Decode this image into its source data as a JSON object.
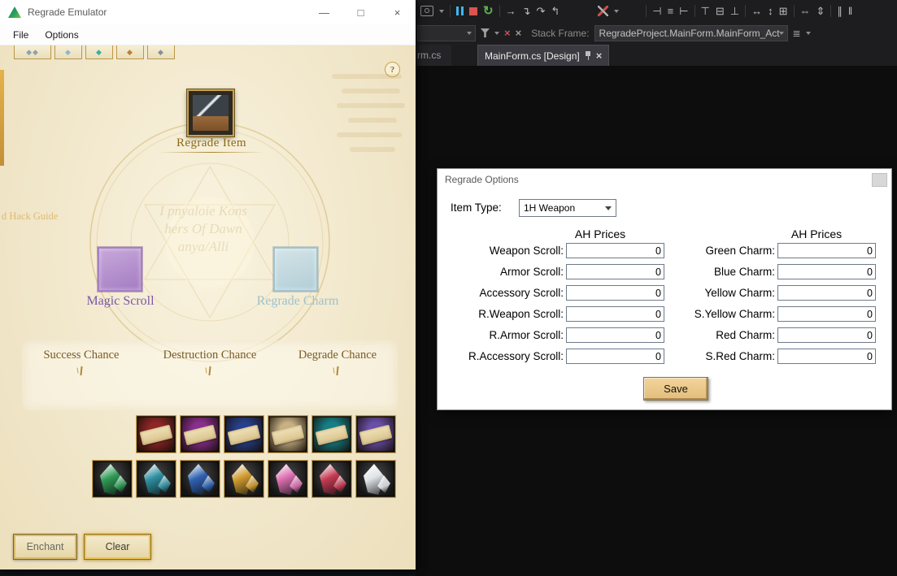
{
  "colors": {
    "parchment": "#f1e8cf",
    "gold_trim": "#c9a24a",
    "vs_background": "#0d0d0e",
    "save_button": "#e8c485"
  },
  "emulator": {
    "title": "Regrade Emulator",
    "menu": {
      "file": "File",
      "options": "Options"
    },
    "controls": {
      "minimize": "—",
      "maximize": "□",
      "close": "×"
    },
    "help": "?",
    "labels": {
      "regrade_item": "Regrade Item",
      "magic_scroll": "Magic Scroll",
      "regrade_charm": "Regrade Charm"
    },
    "chances": [
      "Success Chance",
      "Destruction Chance",
      "Degrade Chance"
    ],
    "buttons": {
      "enchant": "Enchant",
      "clear": "Clear"
    },
    "watermarks": {
      "side": "d Hack Guide",
      "circle": [
        "I pnyaloie Kons",
        "hers Of Dawn",
        "anya/Alli"
      ]
    },
    "tabs": [
      {
        "glyph": "◆◆",
        "color": "#8fa3ad"
      },
      {
        "glyph": "◆",
        "color": "#96b4c6"
      },
      {
        "glyph": "◆",
        "color": "#3fae9a"
      },
      {
        "glyph": "◆",
        "color": "#b7822f"
      },
      {
        "glyph": "◆",
        "color": "#8d8d95"
      }
    ],
    "scrolls": [
      {
        "name": "red-scroll",
        "color": "#8e2626"
      },
      {
        "name": "purple-scroll",
        "color": "#8a2f8f"
      },
      {
        "name": "blue-scroll",
        "color": "#27408b"
      },
      {
        "name": "tan-scroll",
        "color": "#c8b184"
      },
      {
        "name": "teal-scroll",
        "color": "#167f86"
      },
      {
        "name": "violet-scroll",
        "color": "#6a4fa8"
      }
    ],
    "crystals": [
      {
        "name": "green-crystal",
        "color": "#2e9a55"
      },
      {
        "name": "teal-crystal",
        "color": "#2e8fa0"
      },
      {
        "name": "blue-crystal",
        "color": "#2f62b0"
      },
      {
        "name": "gold-crystal",
        "color": "#cf9a2e"
      },
      {
        "name": "pink-crystal",
        "color": "#db6fb0"
      },
      {
        "name": "red-crystal",
        "color": "#c43a52"
      },
      {
        "name": "white-crystal",
        "color": "#dfe3e8"
      }
    ]
  },
  "options": {
    "title": "Regrade Options",
    "item_type_label": "Item Type:",
    "item_type_value": "1H Weapon",
    "left": {
      "header": "AH Prices",
      "rows": [
        {
          "label": "Weapon Scroll:",
          "value": "0"
        },
        {
          "label": "Armor Scroll:",
          "value": "0"
        },
        {
          "label": "Accessory Scroll:",
          "value": "0"
        },
        {
          "label": "R.Weapon Scroll:",
          "value": "0"
        },
        {
          "label": "R.Armor Scroll:",
          "value": "0"
        },
        {
          "label": "R.Accessory Scroll:",
          "value": "0"
        }
      ]
    },
    "right": {
      "header": "AH Prices",
      "rows": [
        {
          "label": "Green Charm:",
          "value": "0"
        },
        {
          "label": "Blue Charm:",
          "value": "0"
        },
        {
          "label": "Yellow Charm:",
          "value": "0"
        },
        {
          "label": "S.Yellow Charm:",
          "value": "0"
        },
        {
          "label": "Red Charm:",
          "value": "0"
        },
        {
          "label": "S.Red Charm:",
          "value": "0"
        }
      ]
    },
    "save": "Save"
  },
  "vs": {
    "stack_frame_label": "Stack Frame:",
    "stack_frame_value": "RegradeProject.MainForm.MainForm_Act",
    "tab_partial": "rm.cs",
    "tab_design": "MainForm.cs [Design]",
    "misc": {
      "close": "×",
      "clear1": "×",
      "clear2": "×",
      "watch": "≣"
    },
    "debug": {
      "restart": "↻",
      "next": "→",
      "step_into": "↴",
      "step_over": "↷",
      "step_out": "↰"
    },
    "designer_icons": [
      {
        "name": "align-lefts",
        "glyph": "⊣"
      },
      {
        "name": "align-centers",
        "glyph": "≡"
      },
      {
        "name": "align-rights",
        "glyph": "⊢"
      },
      {
        "name": "align-tops",
        "glyph": "⊤"
      },
      {
        "name": "align-middles",
        "glyph": "⊟"
      },
      {
        "name": "align-bottoms",
        "glyph": "⊥"
      },
      {
        "name": "make-same-width",
        "glyph": "↔"
      },
      {
        "name": "make-same-height",
        "glyph": "↕"
      },
      {
        "name": "make-same-size",
        "glyph": "⊞"
      },
      {
        "name": "horizontal-spacing",
        "glyph": "⇔"
      },
      {
        "name": "vertical-spacing",
        "glyph": "⇕"
      },
      {
        "name": "bring-to-front",
        "glyph": "∥"
      },
      {
        "name": "send-to-back",
        "glyph": "‖"
      }
    ]
  }
}
